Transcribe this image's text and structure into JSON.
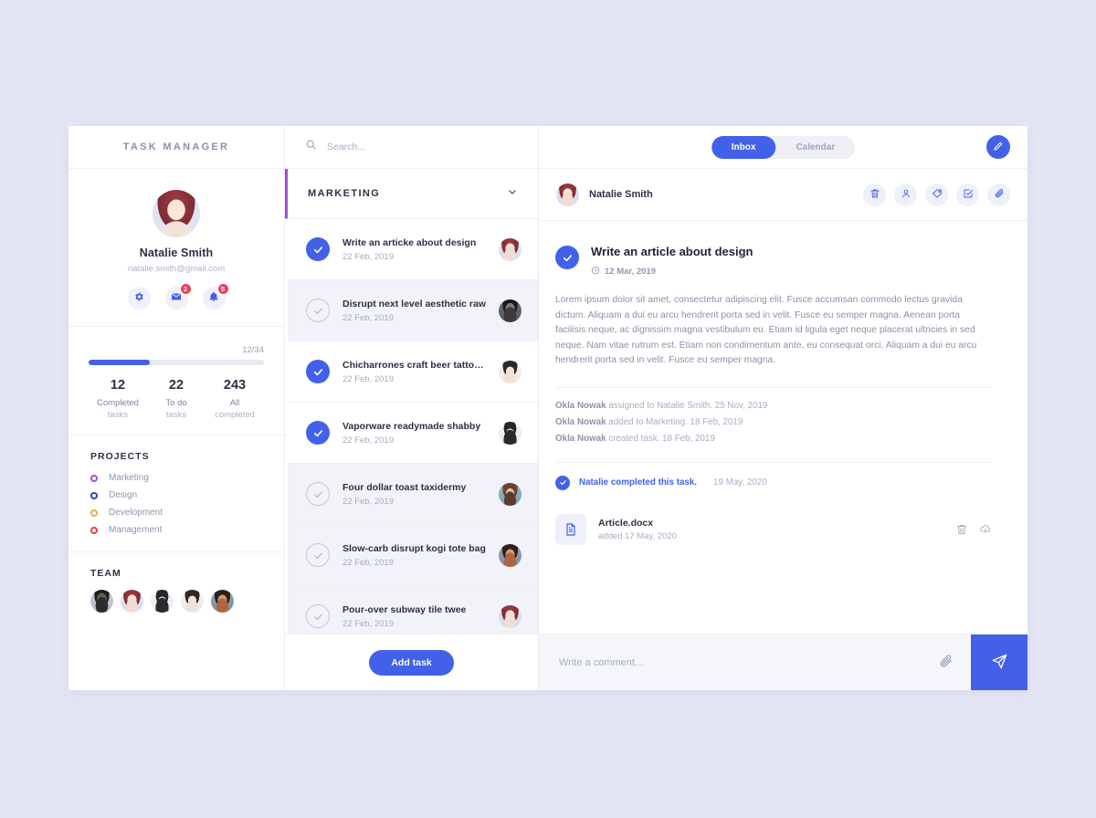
{
  "app": {
    "brand": "TASK MANAGER",
    "background_color": "#e3e5f3",
    "accent_color": "#4361e8",
    "group_accent_color": "#a24ce0"
  },
  "sidebar": {
    "profile": {
      "name": "Natalie Smith",
      "email": "natalie.smith@gmail.com"
    },
    "quick_actions": [
      {
        "name": "settings",
        "icon": "gear-icon",
        "badge": ""
      },
      {
        "name": "messages",
        "icon": "envelope-icon",
        "badge": "2"
      },
      {
        "name": "notifications",
        "icon": "bell-icon",
        "badge": "5"
      }
    ],
    "progress": {
      "label": "12/34",
      "percent": 35
    },
    "stats": [
      {
        "number": "12",
        "line1": "Completed",
        "line2": "tasks"
      },
      {
        "number": "22",
        "line1": "To do",
        "line2": "tasks"
      },
      {
        "number": "243",
        "line1": "All",
        "line2": "completed"
      }
    ],
    "projects_title": "PROJECTS",
    "projects": [
      {
        "label": "Marketing",
        "color": "#a24ce0"
      },
      {
        "label": "Design",
        "color": "#3a3dc4"
      },
      {
        "label": "Development",
        "color": "#f0ae3c"
      },
      {
        "label": "Management",
        "color": "#ef3b54"
      }
    ],
    "team_title": "TEAM",
    "team": [
      {
        "name": "team-member-1"
      },
      {
        "name": "team-member-2"
      },
      {
        "name": "team-member-3"
      },
      {
        "name": "team-member-4"
      },
      {
        "name": "team-member-5"
      }
    ]
  },
  "search": {
    "placeholder": "Search...",
    "value": ""
  },
  "task_list": {
    "group_name": "MARKETING",
    "add_button": "Add task",
    "tasks": [
      {
        "title": "Write an articke about design",
        "date": "22 Feb, 2019",
        "completed": true,
        "selected": false
      },
      {
        "title": "Disrupt next level aesthetic raw",
        "date": "22 Feb, 2019",
        "completed": false,
        "selected": true
      },
      {
        "title": "Chicharrones craft beer tattooed",
        "date": "22 Feb, 2019",
        "completed": true,
        "selected": false
      },
      {
        "title": "Vaporware readymade shabby",
        "date": "22 Feb, 2019",
        "completed": true,
        "selected": false
      },
      {
        "title": "Four dollar toast taxidermy",
        "date": "22 Feb, 2019",
        "completed": false,
        "selected": true
      },
      {
        "title": "Slow-carb disrupt kogi tote bag",
        "date": "22 Feb, 2019",
        "completed": false,
        "selected": true
      },
      {
        "title": "Pour-over subway tile twee",
        "date": "22 Feb, 2019",
        "completed": false,
        "selected": true
      }
    ]
  },
  "detail": {
    "tabs": [
      {
        "label": "Inbox",
        "active": true
      },
      {
        "label": "Calendar",
        "active": false
      }
    ],
    "compose_icon": "pencil-icon",
    "owner_name": "Natalie Smith",
    "action_icons": [
      {
        "name": "delete-icon"
      },
      {
        "name": "assign-user-icon"
      },
      {
        "name": "tag-icon"
      },
      {
        "name": "edit-task-icon"
      },
      {
        "name": "attach-icon"
      }
    ],
    "task": {
      "title": "Write an article about design",
      "date": "12 Mar, 2019",
      "completed": true,
      "description": "Lorem ipsum dolor sit amet, consectetur adipiscing elit. Fusce accumsan commodo lectus gravida dictum. Aliquam a dui eu arcu hendrerit porta sed in velit. Fusce eu semper magna. Aenean porta facilisis neque, ac dignissim magna vestibulum eu. Etiam id ligula eget neque placerat ultricies in sed neque. Nam vitae rutrum est. Etiam non condimentum ante, eu consequat orci. Aliquam a dui eu arcu hendrerit porta sed in velit. Fusce eu semper magna."
    },
    "activity": [
      {
        "actor": "Okla Nowak",
        "text": " assigned to Natalie Smith. 25 Nov, 2019"
      },
      {
        "actor": "Okla Nowak",
        "text": " added to Marketing. 18 Feb, 2019"
      },
      {
        "actor": "Okla Nowak",
        "text": " created task. 18 Feb, 2019"
      }
    ],
    "completed_note": {
      "text": "Natalie completed this task.",
      "date": "19 May, 2020"
    },
    "attachment": {
      "name": "Article.docx",
      "meta": "added 17 May, 2020",
      "actions": [
        {
          "name": "delete-file-icon"
        },
        {
          "name": "download-file-icon"
        }
      ]
    },
    "comment": {
      "placeholder": "Write a comment...",
      "value": "",
      "attach_icon": "paperclip-icon",
      "send_icon": "send-icon"
    }
  }
}
